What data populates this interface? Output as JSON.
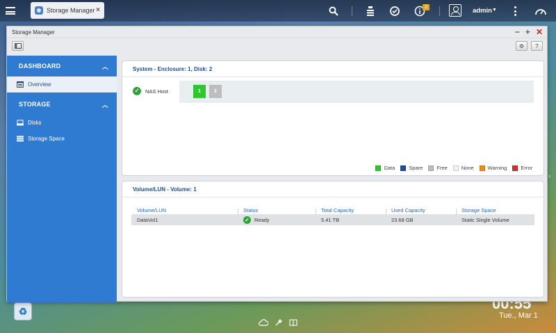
{
  "taskbar": {
    "app_tab_label": "Storage Manager",
    "notification_count": "2",
    "user_name": "admin"
  },
  "window": {
    "title": "Storage Manager"
  },
  "sidebar": {
    "sections": [
      {
        "label": "DASHBOARD",
        "items": [
          {
            "label": "Overview",
            "icon": "overview-icon",
            "active": true
          }
        ]
      },
      {
        "label": "STORAGE",
        "items": [
          {
            "label": "Disks",
            "icon": "disk-icon"
          },
          {
            "label": "Storage Space",
            "icon": "storage-space-icon"
          }
        ]
      }
    ]
  },
  "system_panel": {
    "title": "System - Enclosure: 1, Disk: 2",
    "nas_label": "NAS Host",
    "disks": [
      {
        "label": "1",
        "state": "Data",
        "color": "#2ec82e"
      },
      {
        "label": "2",
        "state": "Free",
        "color": "#bdbdbd"
      }
    ],
    "legend": [
      {
        "label": "Data",
        "color": "#2ec82e"
      },
      {
        "label": "Spare",
        "color": "#1e4f9c"
      },
      {
        "label": "Free",
        "color": "#bdbdbd"
      },
      {
        "label": "None",
        "color": "#eef3f5"
      },
      {
        "label": "Warning",
        "color": "#f08a1c"
      },
      {
        "label": "Error",
        "color": "#c0392b"
      }
    ]
  },
  "volume_panel": {
    "title": "Volume/LUN - Volume: 1",
    "columns": [
      "Volume/LUN",
      "Status",
      "Total Capacity",
      "Used Capacity",
      "Storage Space"
    ],
    "rows": [
      {
        "volume": "DataVol1",
        "status": "Ready",
        "total": "5.41 TB",
        "used": "23.68 GB",
        "space": "Static Single Volume"
      }
    ]
  },
  "desktop": {
    "date": "Tue., Mar 1",
    "time_partial": "00:55"
  },
  "colors": {
    "sidebar": "#2f7bd1",
    "accent_text": "#1f4e8a",
    "close": "#d0281e"
  }
}
